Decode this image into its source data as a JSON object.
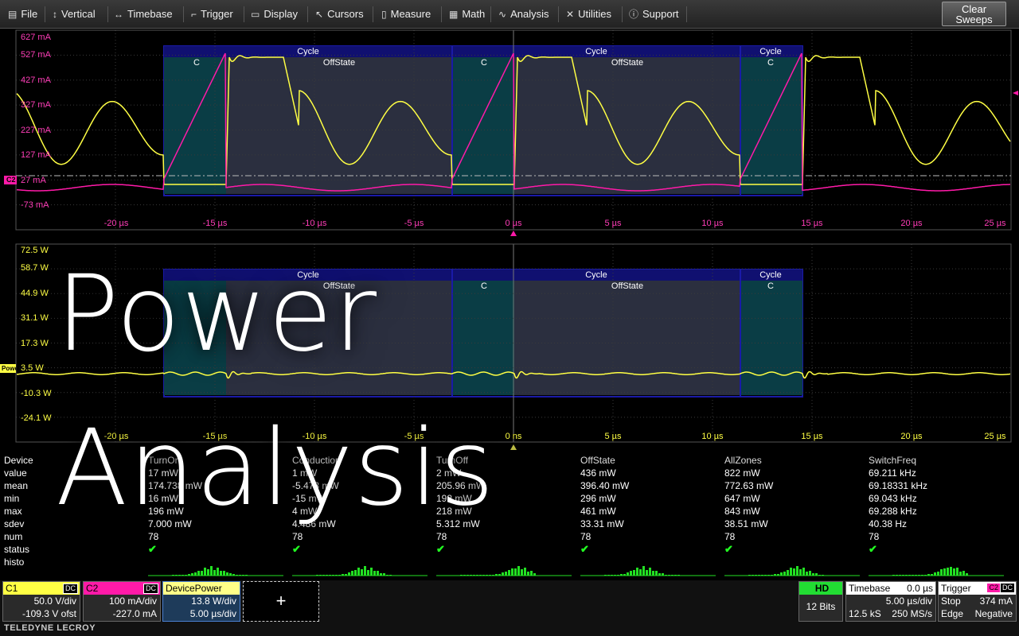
{
  "menu": {
    "items": [
      {
        "label": "File",
        "icon": "file-icon",
        "glyph": "▤"
      },
      {
        "label": "Vertical",
        "icon": "vertical-arrows-icon",
        "glyph": "↕"
      },
      {
        "label": "Timebase",
        "icon": "horizontal-arrows-icon",
        "glyph": "↔"
      },
      {
        "label": "Trigger",
        "icon": "trigger-icon",
        "glyph": "⌐"
      },
      {
        "label": "Display",
        "icon": "display-icon",
        "glyph": "▭"
      },
      {
        "label": "Cursors",
        "icon": "cursor-icon",
        "glyph": "↖"
      },
      {
        "label": "Measure",
        "icon": "measure-icon",
        "glyph": "▯"
      },
      {
        "label": "Math",
        "icon": "math-icon",
        "glyph": "▦"
      },
      {
        "label": "Analysis",
        "icon": "analysis-icon",
        "glyph": "∿"
      },
      {
        "label": "Utilities",
        "icon": "utilities-icon",
        "glyph": "✕"
      },
      {
        "label": "Support",
        "icon": "support-icon",
        "glyph": "ⓘ"
      }
    ],
    "clear_line1": "Clear",
    "clear_line2": "Sweeps"
  },
  "colors": {
    "c1": "#ffff44",
    "c2": "#ff1aa8",
    "zone_teal": "#0a3d45",
    "zone_gray": "#2b2f3f",
    "zone_border": "#1a1aa8",
    "grid": "#444",
    "histo": "#22e022",
    "status_ok": "#22ff22"
  },
  "upper_grid": {
    "y_labels": [
      "627 mA",
      "527 mA",
      "427 mA",
      "327 mA",
      "227 mA",
      "127 mA",
      "27 mA",
      "-73 mA"
    ],
    "x_labels": [
      "-20 µs",
      "-15 µs",
      "-10 µs",
      "-5 µs",
      "0 µs",
      "5 µs",
      "10 µs",
      "15 µs",
      "20 µs",
      "25 µs"
    ],
    "channel_tag": "C2",
    "zones": [
      "Cycle",
      "C",
      "OffState",
      "C",
      "Cycle",
      "OffState",
      "C",
      "Cycle"
    ]
  },
  "lower_grid": {
    "y_labels": [
      "72.5 W",
      "58.7 W",
      "44.9 W",
      "31.1 W",
      "17.3 W",
      "3.5 W",
      "-10.3 W",
      "-24.1 W"
    ],
    "x_labels": [
      "-20 µs",
      "-15 µs",
      "-10 µs",
      "-5 µs",
      "0 ns",
      "5 µs",
      "10 µs",
      "15 µs",
      "20 µs",
      "25 µs"
    ],
    "channel_tag": "Power",
    "zones": [
      "Cycle",
      "OffState",
      "C",
      "Cycle",
      "OffState",
      "Cycle",
      "C"
    ]
  },
  "overlay": {
    "line1": "Power",
    "line2": "Analysis"
  },
  "measure": {
    "row_labels": [
      "Device",
      "value",
      "mean",
      "min",
      "max",
      "sdev",
      "num",
      "status",
      "histo"
    ],
    "columns": [
      {
        "header": "TurnOn",
        "value": "17 mW",
        "mean": "174.738 mW",
        "min": "16 mW",
        "max": "196 mW",
        "sdev": "7.000 mW",
        "num": "78"
      },
      {
        "header": "Conduction",
        "value": "1 mW",
        "mean": "-5.473 mW",
        "min": "-15 mW",
        "max": "4 mW",
        "sdev": "4.486 mW",
        "num": "78"
      },
      {
        "header": "TurnOff",
        "value": "2 mW",
        "mean": "205.96 mW",
        "min": "192 mW",
        "max": "218 mW",
        "sdev": "5.312 mW",
        "num": "78"
      },
      {
        "header": "OffState",
        "value": "436 mW",
        "mean": "396.40 mW",
        "min": "296 mW",
        "max": "461 mW",
        "sdev": "33.31 mW",
        "num": "78"
      },
      {
        "header": "AllZones",
        "value": "822 mW",
        "mean": "772.63 mW",
        "min": "647 mW",
        "max": "843 mW",
        "sdev": "38.51 mW",
        "num": "78"
      },
      {
        "header": "SwitchFreq",
        "value": "69.211 kHz",
        "mean": "69.18331 kHz",
        "min": "69.043 kHz",
        "max": "69.288 kHz",
        "sdev": "40.38 Hz",
        "num": "78"
      }
    ],
    "status_glyph": "✔"
  },
  "footer": {
    "c1": {
      "name": "C1",
      "coupling": "DC",
      "line1": "50.0 V/div",
      "line2": "-109.3 V ofst"
    },
    "c2": {
      "name": "C2",
      "coupling": "DC",
      "line1": "100 mA/div",
      "line2": "-227.0 mA"
    },
    "math": {
      "name": "DevicePower",
      "line1": "13.8 W/div",
      "line2": "5.00 µs/div"
    },
    "add_glyph": "+",
    "hd": {
      "label": "HD",
      "bits": "12 Bits"
    },
    "timebase": {
      "title": "Timebase",
      "delay": "0.0 µs",
      "tdiv": "5.00 µs/div",
      "samples": "12.5 kS",
      "rate": "250 MS/s"
    },
    "trigger": {
      "title": "Trigger",
      "src": "C2",
      "coupling": "DC",
      "mode": "Stop",
      "level": "374 mA",
      "type": "Edge",
      "slope": "Negative"
    },
    "brand": "TELEDYNE LECROY"
  }
}
